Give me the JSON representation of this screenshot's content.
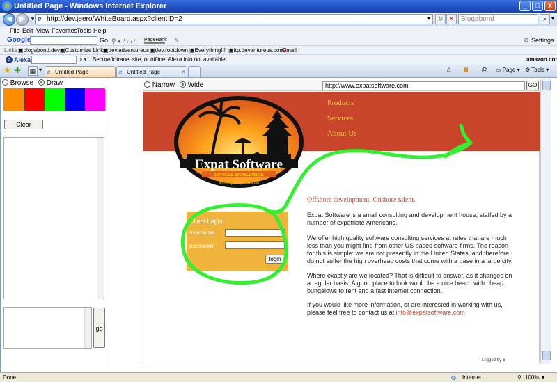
{
  "window": {
    "title": "Untitled Page - Windows Internet Explorer",
    "minimize": "_",
    "maximize": "□",
    "close": "x"
  },
  "address": {
    "url": "http://dev.jeero/WhiteBoard.aspx?clientID=2",
    "search_text": "Blogabond"
  },
  "menu": [
    "File",
    "Edit",
    "View",
    "Favorites",
    "Tools",
    "Help"
  ],
  "google_toolbar": {
    "brand": "Google",
    "go_label": "Go",
    "pagerank_label": "PageRank",
    "settings_label": "Settings"
  },
  "links": {
    "label": "Links",
    "items": [
      "blogabond.dev",
      "Customize Links",
      "dev.adventureus",
      "dev.rootdown",
      "Everything!!!",
      "ftp.deventureus.com",
      "Gmail"
    ]
  },
  "alexa": {
    "brand": "Alexa",
    "message": "Secure/Intranet site, or offline. Alexa info not available.",
    "amazon": "amazon.com"
  },
  "tabs": {
    "items": [
      "Untitled Page",
      "Untitled Page"
    ],
    "page_label": "Page",
    "tools_label": "Tools"
  },
  "whiteboard": {
    "mode_browse": "Browse",
    "mode_draw": "Draw",
    "selected_mode": "Draw",
    "colors": [
      "#ff8c00",
      "#ff0000",
      "#00ff00",
      "#0000ff",
      "#ff00ff"
    ],
    "clear_label": "Clear",
    "go_label": "go",
    "width_narrow": "Narrow",
    "width_wide": "Wide",
    "selected_width": "Wide",
    "browse_url": "http://www.expatsoftware.com",
    "browse_go": "GO"
  },
  "site": {
    "nav": [
      "Products",
      "Services",
      "About Us"
    ],
    "logo_title": "Expat Software",
    "logo_subtitle": "OFFICES WORLDWIDE",
    "logo_url": "www.expatsoftware.com",
    "login_heading": "Client Login:",
    "username_label": "username",
    "password_label": "password",
    "login_button": "login",
    "tagline": "Offshore development, Onshore talent.",
    "p1": "Expat Software is a small consulting and development house, staffed by a number of expatriate Americans.",
    "p2": "We offer high quality software consulting services at rates that are much less than you might find from other US based software firms. The reason for this is simple: we are not presently in the United States, and therefore do not suffer the high overhead costs that come with a base in a large city.",
    "p3": "Where exactly are we located? That is difficult to answer, as it changes on a regular basis. A good place to look would be a nice beach with cheap bungalows to rent and a fast internet connection.",
    "p4_prefix": "If you would like more information, or are interested in working with us, please feel free to contact us at ",
    "email": "info@expatsoftware.com",
    "logged_by": "Logged by"
  },
  "status": {
    "left": "Done",
    "zone": "Internet",
    "zoom": "100%"
  },
  "colors": {
    "annotation_stroke": "#33ee33",
    "banner": "#c8452b",
    "login_box": "#f0b43c",
    "link_orange": "#f5c84e"
  }
}
